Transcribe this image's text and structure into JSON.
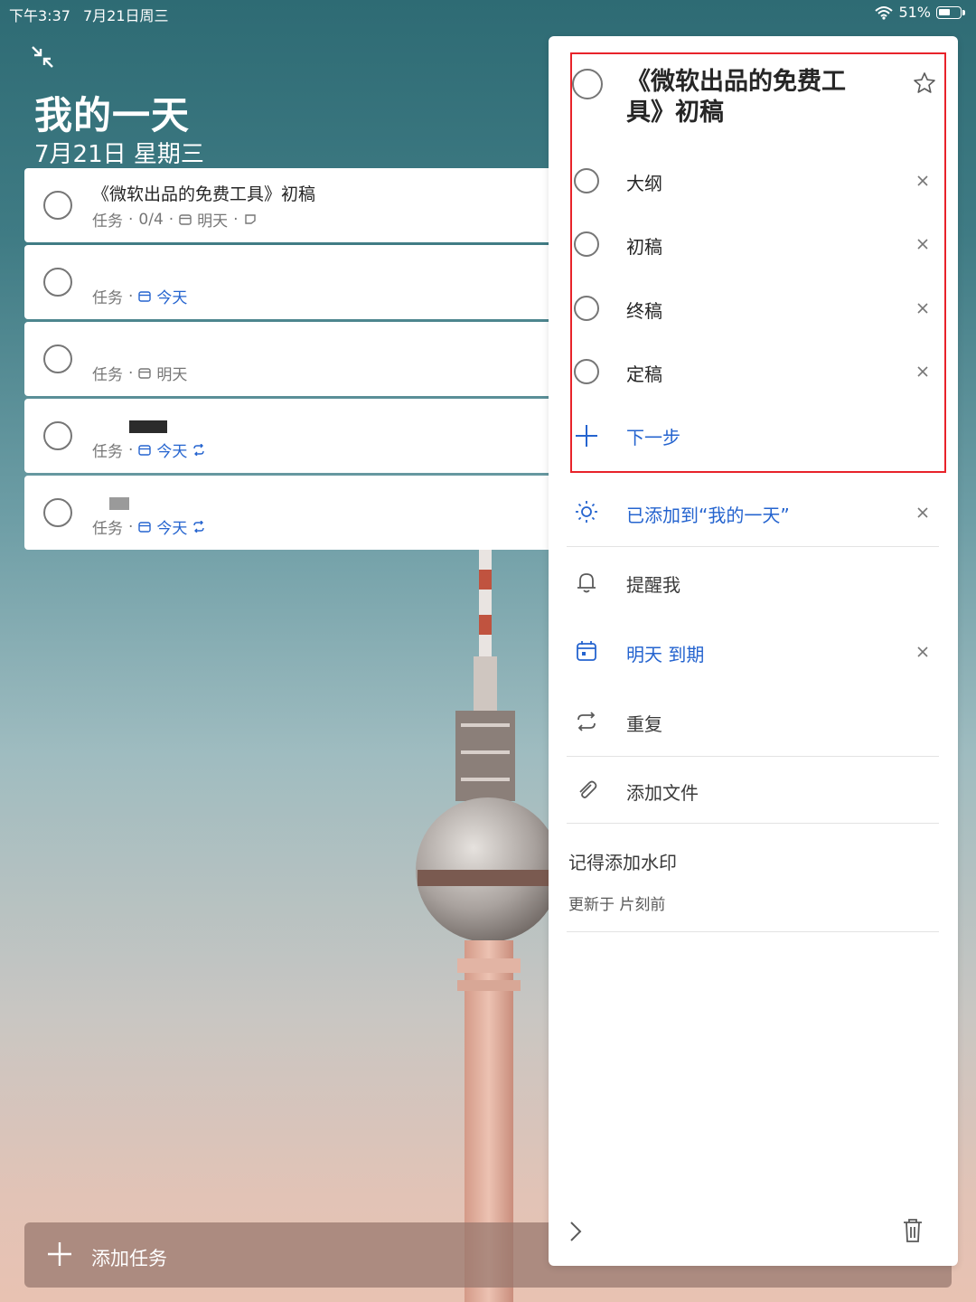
{
  "status_bar": {
    "time": "下午3:37",
    "date": "7月21日周三",
    "battery": "51%"
  },
  "header": {
    "title": "我的一天",
    "date": "7月21日 星期三"
  },
  "tasks": [
    {
      "title": "《微软出品的免费工具》初稿",
      "type": "任务",
      "progress": "0/4",
      "due": "明天",
      "due_color": "#767676",
      "has_note": true,
      "repeat": false
    },
    {
      "title": "",
      "type": "任务",
      "due": "今天",
      "due_color": "#2564cf",
      "repeat": false
    },
    {
      "title": "",
      "type": "任务",
      "due": "明天",
      "due_color": "#767676",
      "repeat": false
    },
    {
      "title": "",
      "type": "任务",
      "due": "今天",
      "due_color": "#2564cf",
      "repeat": true
    },
    {
      "title": "",
      "type": "任务",
      "due": "今天",
      "due_color": "#2564cf",
      "repeat": true
    }
  ],
  "add_task": {
    "label": "添加任务"
  },
  "detail": {
    "title": "《微软出品的免费工具》初稿",
    "steps": [
      "大纲",
      "初稿",
      "终稿",
      "定稿"
    ],
    "next_step": "下一步",
    "my_day": "已添加到“我的一天”",
    "remind": "提醒我",
    "due": "明天 到期",
    "repeat": "重复",
    "add_file": "添加文件",
    "note": "记得添加水印",
    "updated": "更新于 片刻前"
  },
  "colors": {
    "accent": "#2564cf",
    "highlight_border": "#e8232a"
  },
  "icons": [
    "collapse-icon",
    "wifi-icon",
    "battery-icon",
    "calendar-icon",
    "repeat-icon",
    "note-icon",
    "star-icon",
    "close-icon",
    "plus-icon",
    "sun-icon",
    "bell-icon",
    "attach-icon",
    "chevron-right-icon",
    "trash-icon"
  ]
}
